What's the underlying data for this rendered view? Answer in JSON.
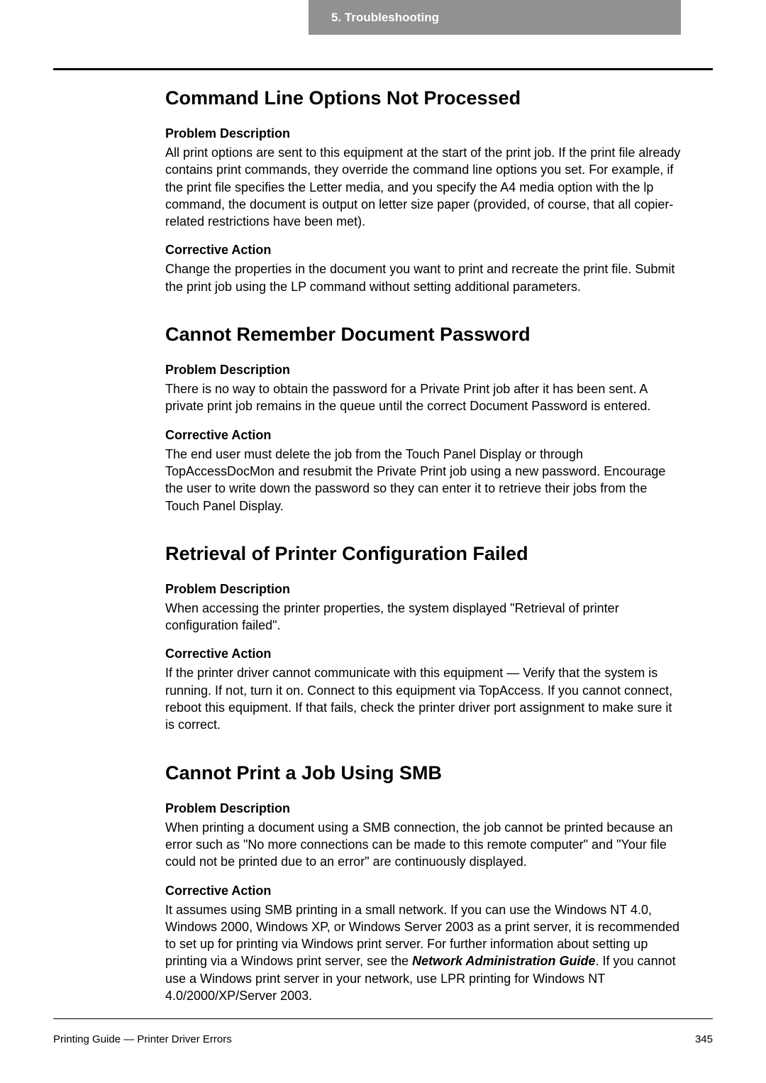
{
  "header": {
    "chapter": "5.  Troubleshooting"
  },
  "sections": [
    {
      "title": "Command Line Options Not Processed",
      "problem_label": "Problem Description",
      "problem_text": "All print options are sent to this equipment at the start of the print job. If the print file already contains print commands, they override the command line options you set. For example, if the print file specifies the Letter media, and you specify the A4 media option with the lp command, the document is output on letter size paper (provided, of course, that all copier-related restrictions have been met).",
      "action_label": "Corrective Action",
      "action_text": "Change the properties in the document you want to print and recreate the print file. Submit the print job using the LP command without setting additional parameters."
    },
    {
      "title": "Cannot Remember Document Password",
      "problem_label": "Problem Description",
      "problem_text": "There is no way to obtain the password for a Private Print job after it has been sent. A private print job remains in the queue until the correct Document Password is entered.",
      "action_label": "Corrective Action",
      "action_text": "The end user must delete the job from the Touch Panel Display or through TopAccessDocMon and resubmit the Private Print job using a new password. Encourage the user to write down the password so they can enter it to retrieve their jobs from the Touch Panel Display."
    },
    {
      "title": "Retrieval of Printer Configuration Failed",
      "problem_label": "Problem Description",
      "problem_text": "When accessing the printer properties, the system displayed \"Retrieval of printer configuration failed\".",
      "action_label": "Corrective Action",
      "action_text": "If the printer driver cannot communicate with this equipment — Verify that the system is running. If not, turn it on. Connect to this equipment via TopAccess. If you cannot connect, reboot this equipment. If that fails, check the printer driver port assignment to make sure it is correct."
    },
    {
      "title": "Cannot Print a Job Using SMB",
      "problem_label": "Problem Description",
      "problem_text": "When printing a document using a SMB connection, the job cannot be printed because an error such as \"No more connections can be made to this remote computer\" and \"Your file could not be printed due to an error\" are continuously displayed.",
      "action_label": "Corrective Action",
      "action_text_before": "It assumes using SMB printing in a small network.  If you can use the Windows NT 4.0, Windows 2000, Windows XP, or Windows Server 2003 as a print server, it is recommended to set up for printing via Windows print server.  For further information about setting up printing via a Windows print server, see the ",
      "action_text_emph": "Network Administration Guide",
      "action_text_after": ". If you cannot use a Windows print server in your network, use LPR printing for Windows NT 4.0/2000/XP/Server 2003."
    }
  ],
  "footer": {
    "left": "Printing Guide — Printer Driver Errors",
    "right": "345"
  }
}
